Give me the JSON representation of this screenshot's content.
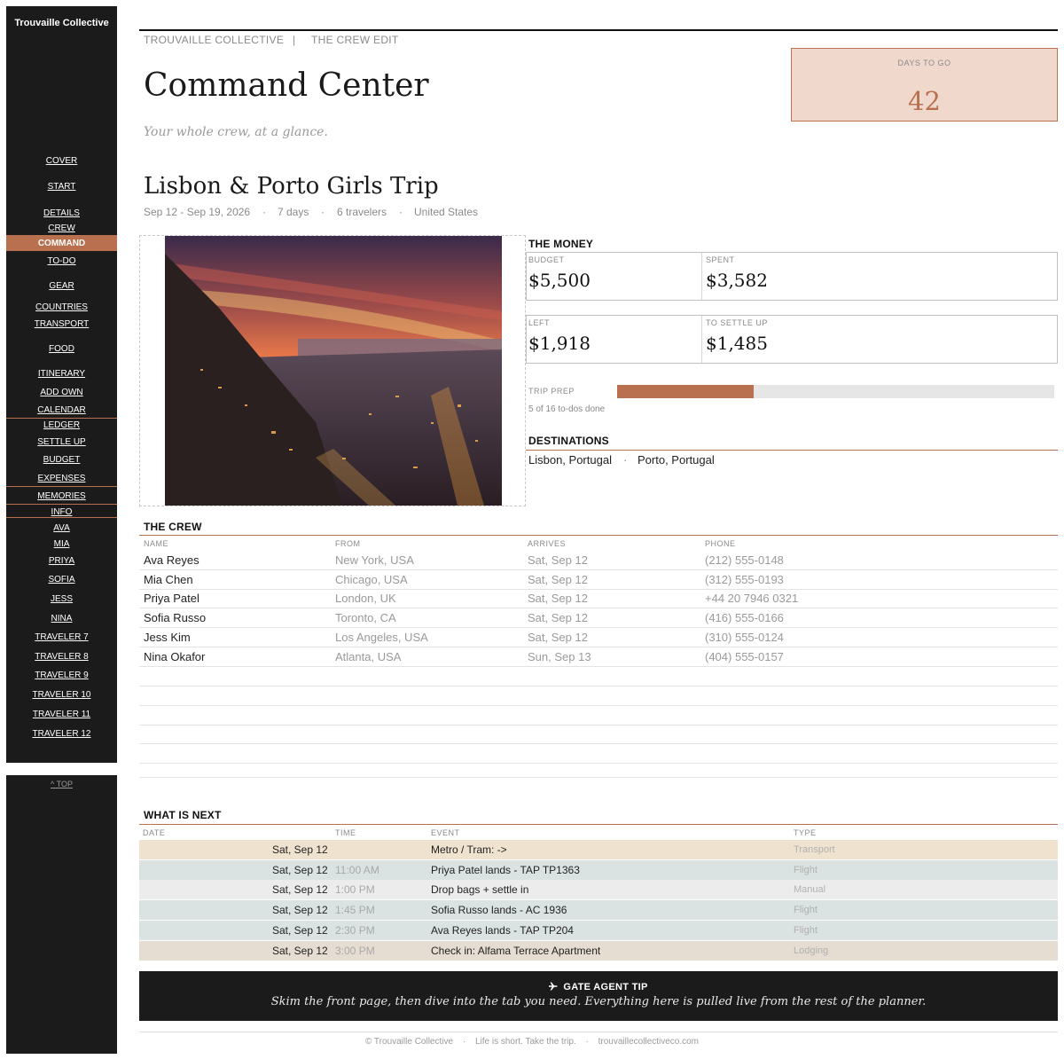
{
  "sidebar": {
    "brand": "Trouvaille Collective",
    "items": [
      "COVER",
      "START",
      "DETAILS",
      "CREW",
      "COMMAND",
      "TO-DO",
      "GEAR",
      "COUNTRIES",
      "TRANSPORT",
      "FOOD",
      "ITINERARY",
      "ADD OWN",
      "CALENDAR",
      "LEDGER",
      "SETTLE UP",
      "BUDGET",
      "EXPENSES",
      "MEMORIES",
      "INFO",
      "AVA",
      "MIA",
      "PRIYA",
      "SOFIA",
      "JESS",
      "NINA",
      "TRAVELER 7",
      "TRAVELER 8",
      "TRAVELER 9",
      "TRAVELER 10",
      "TRAVELER 11",
      "TRAVELER 12"
    ],
    "active": "COMMAND",
    "top_link": "^ TOP"
  },
  "header": {
    "crumb_brand": "TROUVAILLE COLLECTIVE",
    "crumb_sep": "|",
    "crumb_section": "THE CREW EDIT",
    "title": "Command Center",
    "tagline": "Your whole crew, at a glance."
  },
  "countdown": {
    "label": "DAYS TO GO",
    "value": "42"
  },
  "trip": {
    "name": "Lisbon & Porto Girls Trip",
    "dates": "Sep 12 - Sep 19, 2026",
    "duration": "7 days",
    "travelers": "6 travelers",
    "country": "United States",
    "dot": "·"
  },
  "money": {
    "heading": "THE MONEY",
    "budget_label": "BUDGET",
    "budget": "$5,500",
    "spent_label": "SPENT",
    "spent": "$3,582",
    "left_label": "LEFT",
    "left": "$1,918",
    "settle_label": "TO SETTLE UP",
    "settle": "$1,485"
  },
  "prep": {
    "label": "TRIP PREP",
    "done": 5,
    "total": 16,
    "count_text": "5 of 16 to-dos done"
  },
  "destinations": {
    "heading": "DESTINATIONS",
    "items": [
      "Lisbon, Portugal",
      "Porto, Portugal"
    ],
    "dot": "·"
  },
  "crew": {
    "heading": "THE CREW",
    "columns": [
      "NAME",
      "FROM",
      "ARRIVES",
      "PHONE"
    ],
    "rows": [
      [
        "Ava Reyes",
        "New York, USA",
        "Sat, Sep 12",
        "(212) 555-0148"
      ],
      [
        "Mia Chen",
        "Chicago, USA",
        "Sat, Sep 12",
        "(312) 555-0193"
      ],
      [
        "Priya Patel",
        "London, UK",
        "Sat, Sep 12",
        "+44 20 7946 0321"
      ],
      [
        "Sofia Russo",
        "Toronto, CA",
        "Sat, Sep 12",
        "(416) 555-0166"
      ],
      [
        "Jess Kim",
        "Los Angeles, USA",
        "Sat, Sep 12",
        "(310) 555-0124"
      ],
      [
        "Nina Okafor",
        "Atlanta, USA",
        "Sun, Sep 13",
        "(404) 555-0157"
      ]
    ]
  },
  "next": {
    "heading": "WHAT IS NEXT",
    "columns": [
      "DATE",
      "TIME",
      "EVENT",
      "TYPE"
    ],
    "rows": [
      [
        "Sat, Sep 12",
        "",
        "Metro / Tram:  ->",
        "Transport"
      ],
      [
        "Sat, Sep 12",
        "11:00 AM",
        "Priya Patel lands - TAP TP1363",
        "Flight"
      ],
      [
        "Sat, Sep 12",
        "1:00 PM",
        "Drop bags + settle in",
        "Manual"
      ],
      [
        "Sat, Sep 12",
        "1:45 PM",
        "Sofia Russo lands - AC 1936",
        "Flight"
      ],
      [
        "Sat, Sep 12",
        "2:30 PM",
        "Ava Reyes lands - TAP TP204",
        "Flight"
      ],
      [
        "Sat, Sep 12",
        "3:00 PM",
        "Check in: Alfama Terrace Apartment",
        "Lodging"
      ]
    ],
    "type_colors": {
      "Transport": "#efe3cf",
      "Flight": "#dbe3e2",
      "Manual": "#ececec",
      "Lodging": "#e6ddd2"
    }
  },
  "tip": {
    "title": "GATE AGENT TIP",
    "icon": "airplane-icon",
    "body": "Skim the front page, then dive into the tab you need. Everything here is pulled live from the rest of the planner."
  },
  "footer": {
    "copyright": "© Trouvaille Collective",
    "motto": "Life is short. Take the trip.",
    "site": "trouvaillecollectiveco.com",
    "dot": "·"
  },
  "colors": {
    "accent": "#b8704f",
    "sidebar": "#1b1b1b",
    "countdown_bg": "#f0d8cc"
  }
}
